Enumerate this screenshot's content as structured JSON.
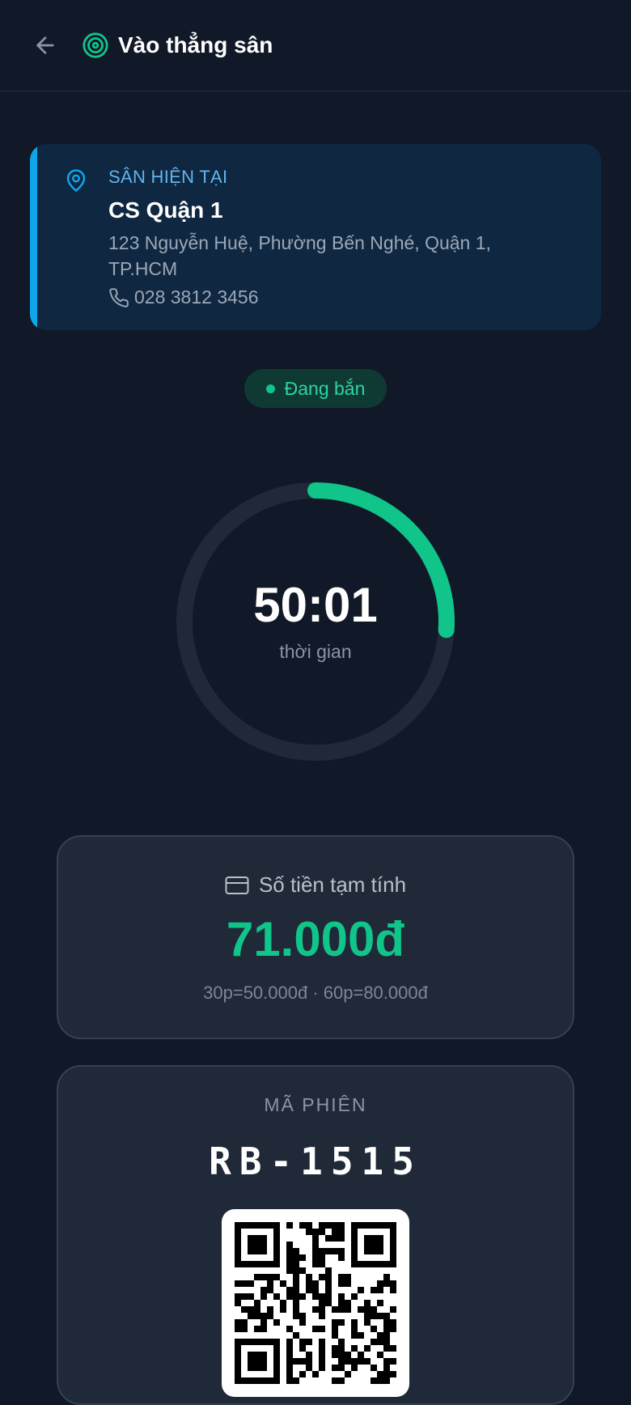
{
  "header": {
    "title": "Vào thẳng sân",
    "back_icon": "arrow-left-icon",
    "title_icon": "target-icon"
  },
  "court": {
    "label": "SÂN HIỆN TẠI",
    "name": "CS Quận 1",
    "address": "123 Nguyễn Huệ, Phường Bến Nghé, Quận 1, TP.HCM",
    "phone": "028 3812 3456"
  },
  "status": {
    "text": "Đang bắn",
    "color": "#10c48a"
  },
  "timer": {
    "value": "50:01",
    "label": "thời gian",
    "progress": 0.26
  },
  "price": {
    "label": "Số tiền tạm tính",
    "value": "71.000đ",
    "rates": "30p=50.000đ · 60p=80.000đ"
  },
  "session": {
    "label": "MÃ PHIÊN",
    "code": "RB-1515"
  },
  "colors": {
    "background": "#111827",
    "accent_green": "#10c48a",
    "accent_blue": "#0ea5e9",
    "card": "#1f2937"
  }
}
